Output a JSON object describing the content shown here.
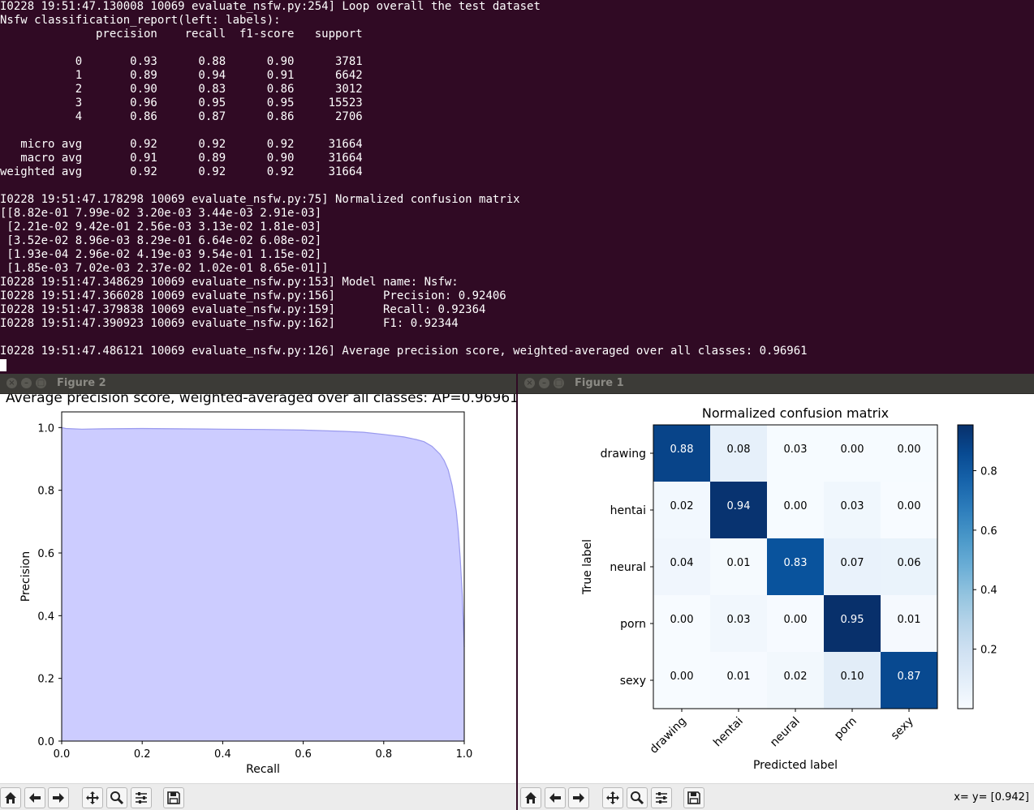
{
  "terminal": {
    "lines": [
      "I0228 19:51:47.130008 10069 evaluate_nsfw.py:254] Loop overall the test dataset",
      "Nsfw classification_report(left: labels):",
      "              precision    recall  f1-score   support",
      "",
      "           0       0.93      0.88      0.90      3781",
      "           1       0.89      0.94      0.91      6642",
      "           2       0.90      0.83      0.86      3012",
      "           3       0.96      0.95      0.95     15523",
      "           4       0.86      0.87      0.86      2706",
      "",
      "   micro avg       0.92      0.92      0.92     31664",
      "   macro avg       0.91      0.89      0.90     31664",
      "weighted avg       0.92      0.92      0.92     31664",
      "",
      "I0228 19:51:47.178298 10069 evaluate_nsfw.py:75] Normalized confusion matrix",
      "[[8.82e-01 7.99e-02 3.20e-03 3.44e-03 2.91e-03]",
      " [2.21e-02 9.42e-01 2.56e-03 3.13e-02 1.81e-03]",
      " [3.52e-02 8.96e-03 8.29e-01 6.64e-02 6.08e-02]",
      " [1.93e-04 2.96e-02 4.19e-03 9.54e-01 1.15e-02]",
      " [1.85e-03 7.02e-03 2.37e-02 1.02e-01 8.65e-01]]",
      "I0228 19:51:47.348629 10069 evaluate_nsfw.py:153] Model name: Nsfw:",
      "I0228 19:51:47.366028 10069 evaluate_nsfw.py:156]       Precision: 0.92406",
      "I0228 19:51:47.379838 10069 evaluate_nsfw.py:159]       Recall: 0.92364",
      "I0228 19:51:47.390923 10069 evaluate_nsfw.py:162]       F1: 0.92344",
      "",
      "I0228 19:51:47.486121 10069 evaluate_nsfw.py:126] Average precision score, weighted-averaged over all classes: 0.96961"
    ]
  },
  "figure2": {
    "window_title": "Figure 2",
    "chart_data": {
      "type": "area",
      "title": "Average precision score, weighted-averaged over all classes: AP=0.96961",
      "xlabel": "Recall",
      "ylabel": "Precision",
      "xlim": [
        0.0,
        1.0
      ],
      "ylim": [
        0.0,
        1.05
      ],
      "xticks": [
        "0.0",
        "0.2",
        "0.4",
        "0.6",
        "0.8",
        "1.0"
      ],
      "yticks": [
        "0.0",
        "0.2",
        "0.4",
        "0.6",
        "0.8",
        "1.0"
      ],
      "x": [
        0.0,
        0.01,
        0.05,
        0.1,
        0.2,
        0.3,
        0.4,
        0.5,
        0.6,
        0.7,
        0.75,
        0.8,
        0.85,
        0.88,
        0.9,
        0.92,
        0.94,
        0.95,
        0.96,
        0.97,
        0.98,
        0.985,
        0.99,
        0.995,
        1.0
      ],
      "y": [
        1.0,
        0.997,
        0.995,
        0.996,
        0.997,
        0.996,
        0.995,
        0.994,
        0.992,
        0.988,
        0.985,
        0.978,
        0.97,
        0.962,
        0.955,
        0.94,
        0.915,
        0.895,
        0.865,
        0.815,
        0.735,
        0.67,
        0.585,
        0.47,
        0.3
      ],
      "fill_color": "#ccccff",
      "line_color": "#9999ee"
    }
  },
  "figure1": {
    "window_title": "Figure 1",
    "chart_data": {
      "type": "heatmap",
      "title": "Normalized confusion matrix",
      "xlabel": "Predicted label",
      "ylabel": "True label",
      "labels": [
        "drawing",
        "hentai",
        "neural",
        "porn",
        "sexy"
      ],
      "values": [
        [
          0.882,
          0.0799,
          0.0032,
          0.00344,
          0.00291
        ],
        [
          0.0221,
          0.942,
          0.00256,
          0.0313,
          0.00181
        ],
        [
          0.0352,
          0.00896,
          0.829,
          0.0664,
          0.0608
        ],
        [
          0.000193,
          0.0296,
          0.00419,
          0.954,
          0.0115
        ],
        [
          0.00185,
          0.00702,
          0.0237,
          0.102,
          0.865
        ]
      ],
      "cell_labels": [
        [
          "0.88",
          "0.08",
          "0.03",
          "0.00",
          "0.00"
        ],
        [
          "0.02",
          "0.94",
          "0.00",
          "0.03",
          "0.00"
        ],
        [
          "0.04",
          "0.01",
          "0.83",
          "0.07",
          "0.06"
        ],
        [
          "0.00",
          "0.03",
          "0.00",
          "0.95",
          "0.01"
        ],
        [
          "0.00",
          "0.01",
          "0.02",
          "0.10",
          "0.87"
        ]
      ],
      "colorbar_ticks": [
        "0.2",
        "0.4",
        "0.6",
        "0.8"
      ],
      "colorbar_values": [
        0.2,
        0.4,
        0.6,
        0.8
      ],
      "colormap": "Blues",
      "vmin": 0.0,
      "vmax": 0.954
    },
    "coord_text": "x= y= [0.942]"
  },
  "toolbar_icons": [
    "home-icon",
    "back-icon",
    "forward-icon",
    "pan-icon",
    "zoom-icon",
    "configure-icon",
    "save-icon"
  ],
  "window_buttons": [
    "close",
    "minimize",
    "maximize"
  ]
}
